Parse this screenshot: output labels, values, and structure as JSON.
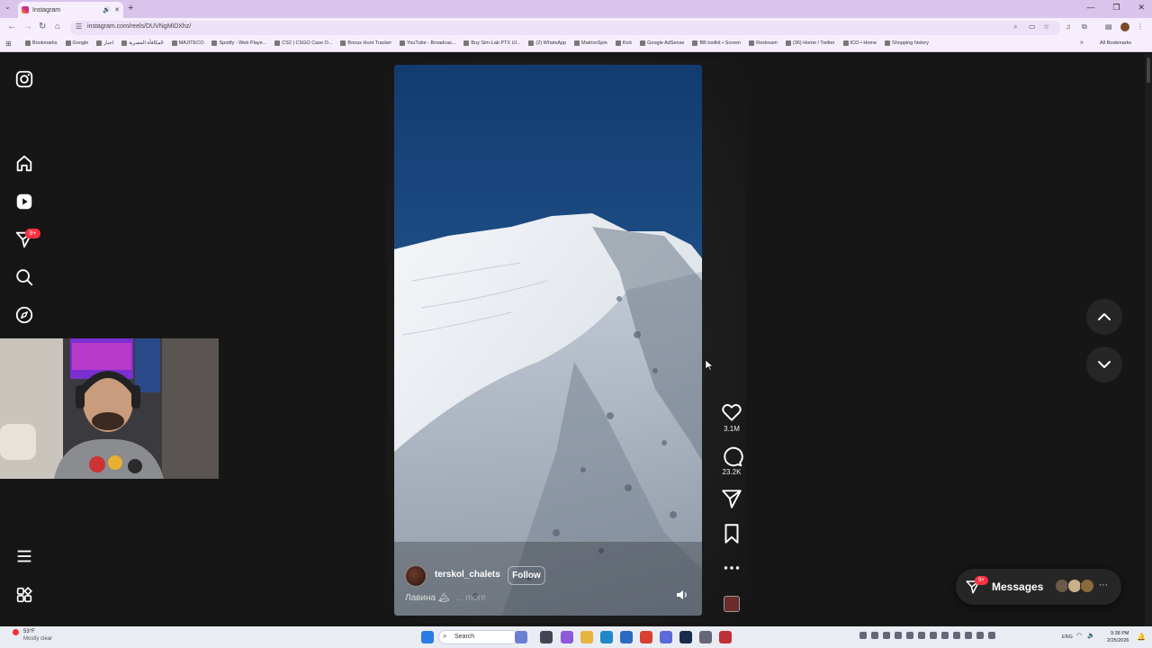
{
  "browser": {
    "tab_title": "Instagram",
    "url": "instagram.com/reels/DUVNgMiDXhz/",
    "new_tab_label": "+",
    "bookmarks": [
      "Bookmarks",
      "Google",
      "اخبار",
      "المكافأة المصرية",
      "MAJITECO",
      "Spotify - Web Playe...",
      "CS2 | CSGO Case O...",
      "Bonus Hunt Tracker",
      "YouTube - Broadcas...",
      "Buy Sim-Lab PTX Ul...",
      "(2) WhatsApp",
      "MatrixxSpin",
      "Kick",
      "Google AdSense",
      "BB toolkit • Screen",
      "Restream",
      "(36) Home / Twitter",
      "ICO • Home",
      "Shopping history"
    ],
    "all_bookmarks_label": "All Bookmarks"
  },
  "sidebar": {
    "notification_badge": "9+"
  },
  "reel": {
    "username": "terskol_chalets",
    "follow_label": "Follow",
    "caption": "Лавина 🏔",
    "more_label": "... more",
    "likes": "3.1M",
    "comments": "23.2K"
  },
  "messages": {
    "label": "Messages",
    "badge": "9+"
  },
  "taskbar": {
    "temperature": "53°F",
    "condition": "Mostly clear",
    "search_label": "Search",
    "language": "ENG",
    "time": "9:38 PM",
    "date": "2/25/2026"
  },
  "colors": {
    "background": "#161616",
    "badge": "#ff3040",
    "sky": "#1c4d85",
    "browser_frame": "#f6eefc"
  }
}
